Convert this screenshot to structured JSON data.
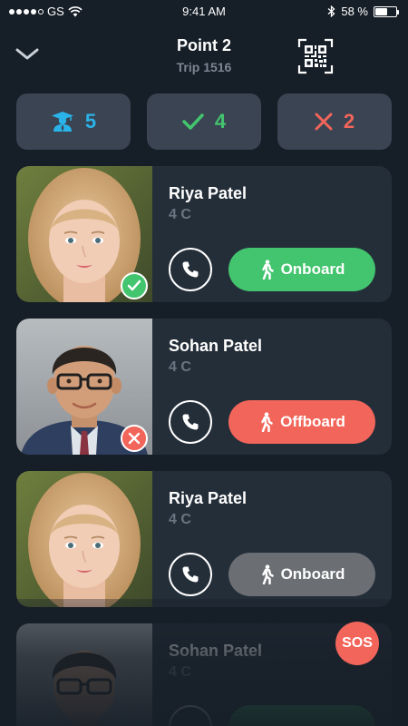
{
  "status_bar": {
    "carrier": "GS",
    "time": "9:41 AM",
    "battery": "58 %",
    "battery_level": 0.58
  },
  "header": {
    "title": "Point 2",
    "subtitle": "Trip 1516"
  },
  "summary": [
    {
      "icon": "student-icon",
      "count": "5",
      "color": "#2ab3e8"
    },
    {
      "icon": "check-icon",
      "count": "4",
      "color": "#43c46e"
    },
    {
      "icon": "cross-icon",
      "count": "2",
      "color": "#f2655a"
    }
  ],
  "students": [
    {
      "name": "Riya Patel",
      "class": "4 C",
      "action": "Onboard",
      "status": "checked",
      "button_color": "#43c46e"
    },
    {
      "name": "Sohan Patel",
      "class": "4 C",
      "action": "Offboard",
      "status": "absent",
      "button_color": "#f2655a"
    },
    {
      "name": "Riya Patel",
      "class": "4 C",
      "action": "Onboard",
      "status": "none",
      "button_color": "#6b6f74"
    },
    {
      "name": "Sohan Patel",
      "class": "4 C",
      "action": "",
      "status": "none",
      "button_color": "#43c46e"
    }
  ],
  "sos": {
    "label": "SOS"
  }
}
